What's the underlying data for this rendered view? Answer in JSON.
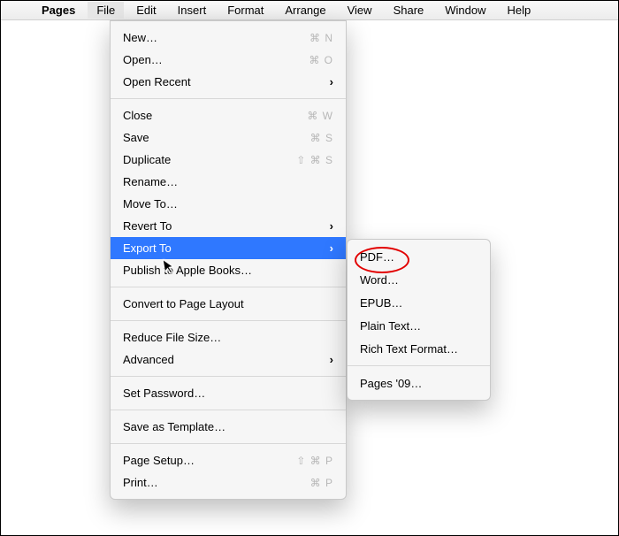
{
  "menubar": {
    "app_name": "Pages",
    "items": [
      "File",
      "Edit",
      "Insert",
      "Format",
      "Arrange",
      "View",
      "Share",
      "Window",
      "Help"
    ]
  },
  "file_menu": {
    "groups": [
      [
        {
          "label": "New…",
          "shortcut": "⌘ N"
        },
        {
          "label": "Open…",
          "shortcut": "⌘ O"
        },
        {
          "label": "Open Recent",
          "chevron": true
        }
      ],
      [
        {
          "label": "Close",
          "shortcut": "⌘ W"
        },
        {
          "label": "Save",
          "shortcut": "⌘ S"
        },
        {
          "label": "Duplicate",
          "shortcut": "⇧ ⌘ S"
        },
        {
          "label": "Rename…"
        },
        {
          "label": "Move To…"
        },
        {
          "label": "Revert To",
          "chevron": true
        },
        {
          "label": "Export To",
          "chevron": true,
          "highlight": true
        },
        {
          "label": "Publish to Apple Books…"
        }
      ],
      [
        {
          "label": "Convert to Page Layout"
        }
      ],
      [
        {
          "label": "Reduce File Size…"
        },
        {
          "label": "Advanced",
          "chevron": true
        }
      ],
      [
        {
          "label": "Set Password…"
        }
      ],
      [
        {
          "label": "Save as Template…"
        }
      ],
      [
        {
          "label": "Page Setup…",
          "shortcut": "⇧ ⌘ P"
        },
        {
          "label": "Print…",
          "shortcut": "⌘ P"
        }
      ]
    ]
  },
  "export_submenu": {
    "groups": [
      [
        {
          "label": "PDF…"
        },
        {
          "label": "Word…"
        },
        {
          "label": "EPUB…"
        },
        {
          "label": "Plain Text…"
        },
        {
          "label": "Rich Text Format…"
        }
      ],
      [
        {
          "label": "Pages '09…"
        }
      ]
    ]
  }
}
